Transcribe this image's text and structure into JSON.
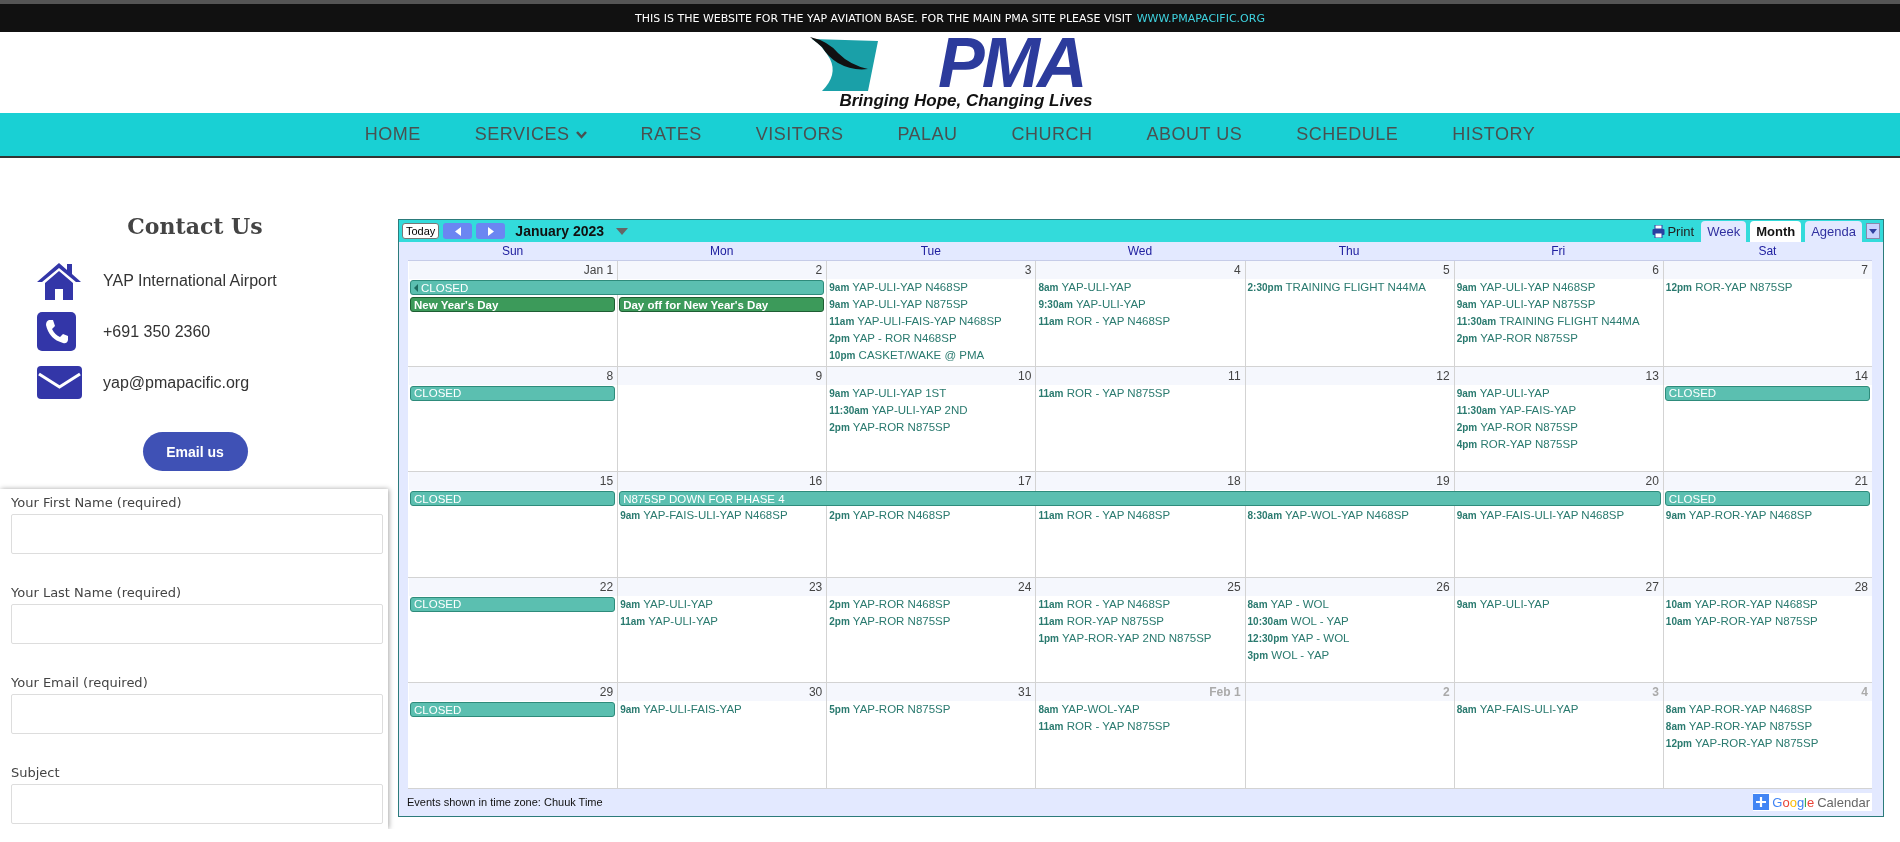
{
  "notice": {
    "text": "THIS IS THE WEBSITE FOR THE YAP AVIATION BASE. FOR THE MAIN PMA SITE PLEASE VISIT",
    "link": "WWW.PMAPACIFIC.ORG"
  },
  "logo": {
    "wordmark": "PMA",
    "tagline": "Bringing Hope, Changing Lives"
  },
  "nav": [
    {
      "label": "HOME",
      "dropdown": false
    },
    {
      "label": "SERVICES",
      "dropdown": true
    },
    {
      "label": "RATES",
      "dropdown": false
    },
    {
      "label": "VISITORS",
      "dropdown": false
    },
    {
      "label": "PALAU",
      "dropdown": false
    },
    {
      "label": "CHURCH",
      "dropdown": false
    },
    {
      "label": "ABOUT US",
      "dropdown": false
    },
    {
      "label": "SCHEDULE",
      "dropdown": false
    },
    {
      "label": "HISTORY",
      "dropdown": false
    }
  ],
  "contact": {
    "title": "Contact Us",
    "items": [
      {
        "kind": "address",
        "text": "YAP International Airport"
      },
      {
        "kind": "phone",
        "text": "+691 350 2360"
      },
      {
        "kind": "email",
        "text": "yap@pmapacific.org"
      }
    ],
    "button": "Email us"
  },
  "form": {
    "fields": [
      {
        "label": "Your First Name (required)"
      },
      {
        "label": "Your Last Name (required)"
      },
      {
        "label": "Your Email (required)"
      },
      {
        "label": "Subject"
      }
    ]
  },
  "calendar": {
    "today": "Today",
    "month": "January 2023",
    "print": "Print",
    "views": [
      {
        "label": "Week",
        "selected": false
      },
      {
        "label": "Month",
        "selected": true
      },
      {
        "label": "Agenda",
        "selected": false
      }
    ],
    "weekdays": [
      "Sun",
      "Mon",
      "Tue",
      "Wed",
      "Thu",
      "Fri",
      "Sat"
    ],
    "weeks": [
      {
        "days": [
          {
            "date": "Jan 1",
            "other_month": false,
            "all_day": [
              {
                "kind": "closed",
                "label": "CLOSED",
                "continued": true
              },
              {
                "kind": "holiday",
                "label": "New Year's Day",
                "continued": false
              }
            ]
          },
          {
            "date": "2",
            "other_month": false,
            "all_day": [
              {
                "kind": "continuation"
              },
              {
                "kind": "holiday",
                "label": "Day off for New Year's Day",
                "continued": false
              }
            ]
          },
          {
            "date": "3",
            "other_month": false,
            "events": [
              {
                "time": "9am",
                "title": "YAP-ULI-YAP N468SP"
              },
              {
                "time": "9am",
                "title": "YAP-ULI-YAP N875SP"
              },
              {
                "time": "11am",
                "title": "YAP-ULI-FAIS-YAP N468SP"
              },
              {
                "time": "2pm",
                "title": "YAP - ROR N468SP"
              },
              {
                "time": "10pm",
                "title": "CASKET/WAKE @ PMA"
              }
            ]
          },
          {
            "date": "4",
            "other_month": false,
            "events": [
              {
                "time": "8am",
                "title": "YAP-ULI-YAP"
              },
              {
                "time": "9:30am",
                "title": "YAP-ULI-YAP"
              },
              {
                "time": "11am",
                "title": "ROR - YAP N468SP"
              }
            ]
          },
          {
            "date": "5",
            "other_month": false,
            "events": [
              {
                "time": "2:30pm",
                "title": "TRAINING FLIGHT N44MA"
              }
            ]
          },
          {
            "date": "6",
            "other_month": false,
            "events": [
              {
                "time": "9am",
                "title": "YAP-ULI-YAP N468SP"
              },
              {
                "time": "9am",
                "title": "YAP-ULI-YAP N875SP"
              },
              {
                "time": "11:30am",
                "title": "TRAINING FLIGHT N44MA"
              },
              {
                "time": "2pm",
                "title": "YAP-ROR N875SP"
              }
            ]
          },
          {
            "date": "7",
            "other_month": false,
            "events": [
              {
                "time": "12pm",
                "title": "ROR-YAP N875SP"
              }
            ]
          }
        ]
      },
      {
        "days": [
          {
            "date": "8",
            "other_month": false,
            "all_day": [
              {
                "kind": "closed",
                "label": "CLOSED",
                "continued": false
              }
            ]
          },
          {
            "date": "9",
            "other_month": false
          },
          {
            "date": "10",
            "other_month": false,
            "events": [
              {
                "time": "9am",
                "title": "YAP-ULI-YAP 1ST"
              },
              {
                "time": "11:30am",
                "title": "YAP-ULI-YAP 2ND"
              },
              {
                "time": "2pm",
                "title": "YAP-ROR N875SP"
              }
            ]
          },
          {
            "date": "11",
            "other_month": false,
            "events": [
              {
                "time": "11am",
                "title": "ROR - YAP N875SP"
              }
            ]
          },
          {
            "date": "12",
            "other_month": false
          },
          {
            "date": "13",
            "other_month": false,
            "events": [
              {
                "time": "9am",
                "title": "YAP-ULI-YAP"
              },
              {
                "time": "11:30am",
                "title": "YAP-FAIS-YAP"
              },
              {
                "time": "2pm",
                "title": "YAP-ROR N875SP"
              },
              {
                "time": "4pm",
                "title": "ROR-YAP N875SP"
              }
            ]
          },
          {
            "date": "14",
            "other_month": false,
            "all_day": [
              {
                "kind": "closed",
                "label": "CLOSED",
                "continued": false
              }
            ]
          }
        ]
      },
      {
        "days": [
          {
            "date": "15",
            "other_month": false,
            "all_day": [
              {
                "kind": "closed",
                "label": "CLOSED",
                "continued": false
              }
            ]
          },
          {
            "date": "16",
            "other_month": false,
            "all_day": [
              {
                "kind": "closed",
                "label": "N875SP DOWN FOR PHASE 4",
                "continued": false
              }
            ],
            "events": [
              {
                "time": "9am",
                "title": "YAP-FAIS-ULI-YAP N468SP"
              }
            ]
          },
          {
            "date": "17",
            "other_month": false,
            "all_day": [
              {
                "kind": "continuation"
              }
            ],
            "events": [
              {
                "time": "2pm",
                "title": "YAP-ROR N468SP"
              }
            ]
          },
          {
            "date": "18",
            "other_month": false,
            "all_day": [
              {
                "kind": "continuation"
              }
            ],
            "events": [
              {
                "time": "11am",
                "title": "ROR - YAP N468SP"
              }
            ]
          },
          {
            "date": "19",
            "other_month": false,
            "all_day": [
              {
                "kind": "continuation"
              }
            ],
            "events": [
              {
                "time": "8:30am",
                "title": "YAP-WOL-YAP N468SP"
              }
            ]
          },
          {
            "date": "20",
            "other_month": false,
            "all_day": [
              {
                "kind": "continuation"
              }
            ],
            "events": [
              {
                "time": "9am",
                "title": "YAP-FAIS-ULI-YAP N468SP"
              }
            ]
          },
          {
            "date": "21",
            "other_month": false,
            "all_day": [
              {
                "kind": "closed",
                "label": "CLOSED",
                "continued": false
              }
            ],
            "events": [
              {
                "time": "9am",
                "title": "YAP-ROR-YAP N468SP"
              }
            ]
          }
        ]
      },
      {
        "days": [
          {
            "date": "22",
            "other_month": false,
            "all_day": [
              {
                "kind": "closed",
                "label": "CLOSED",
                "continued": false
              }
            ]
          },
          {
            "date": "23",
            "other_month": false,
            "events": [
              {
                "time": "9am",
                "title": "YAP-ULI-YAP"
              },
              {
                "time": "11am",
                "title": "YAP-ULI-YAP"
              }
            ]
          },
          {
            "date": "24",
            "other_month": false,
            "events": [
              {
                "time": "2pm",
                "title": "YAP-ROR N468SP"
              },
              {
                "time": "2pm",
                "title": "YAP-ROR N875SP"
              }
            ]
          },
          {
            "date": "25",
            "other_month": false,
            "events": [
              {
                "time": "11am",
                "title": "ROR - YAP N468SP"
              },
              {
                "time": "11am",
                "title": "ROR-YAP N875SP"
              },
              {
                "time": "1pm",
                "title": "YAP-ROR-YAP 2ND N875SP"
              }
            ]
          },
          {
            "date": "26",
            "other_month": false,
            "events": [
              {
                "time": "8am",
                "title": "YAP - WOL"
              },
              {
                "time": "10:30am",
                "title": "WOL - YAP"
              },
              {
                "time": "12:30pm",
                "title": "YAP - WOL"
              },
              {
                "time": "3pm",
                "title": "WOL - YAP"
              }
            ]
          },
          {
            "date": "27",
            "other_month": false,
            "events": [
              {
                "time": "9am",
                "title": "YAP-ULI-YAP"
              }
            ]
          },
          {
            "date": "28",
            "other_month": false,
            "events": [
              {
                "time": "10am",
                "title": "YAP-ROR-YAP N468SP"
              },
              {
                "time": "10am",
                "title": "YAP-ROR-YAP N875SP"
              }
            ]
          }
        ]
      },
      {
        "days": [
          {
            "date": "29",
            "other_month": false,
            "all_day": [
              {
                "kind": "closed",
                "label": "CLOSED",
                "continued": false
              }
            ]
          },
          {
            "date": "30",
            "other_month": false,
            "events": [
              {
                "time": "9am",
                "title": "YAP-ULI-FAIS-YAP"
              }
            ]
          },
          {
            "date": "31",
            "other_month": false,
            "events": [
              {
                "time": "5pm",
                "title": "YAP-ROR N875SP"
              }
            ]
          },
          {
            "date": "Feb 1",
            "other_month": true,
            "events": [
              {
                "time": "8am",
                "title": "YAP-WOL-YAP"
              },
              {
                "time": "11am",
                "title": "ROR - YAP N875SP"
              }
            ]
          },
          {
            "date": "2",
            "other_month": true
          },
          {
            "date": "3",
            "other_month": true,
            "events": [
              {
                "time": "8am",
                "title": "YAP-FAIS-ULI-YAP"
              }
            ]
          },
          {
            "date": "4",
            "other_month": true,
            "events": [
              {
                "time": "8am",
                "title": "YAP-ROR-YAP N468SP"
              },
              {
                "time": "8am",
                "title": "YAP-ROR-YAP N875SP"
              },
              {
                "time": "12pm",
                "title": "YAP-ROR-YAP N875SP"
              }
            ]
          }
        ]
      }
    ],
    "timezone": "Events shown in time zone: Chuuk Time",
    "badge": {
      "brand": "Google",
      "product": "Calendar"
    }
  }
}
